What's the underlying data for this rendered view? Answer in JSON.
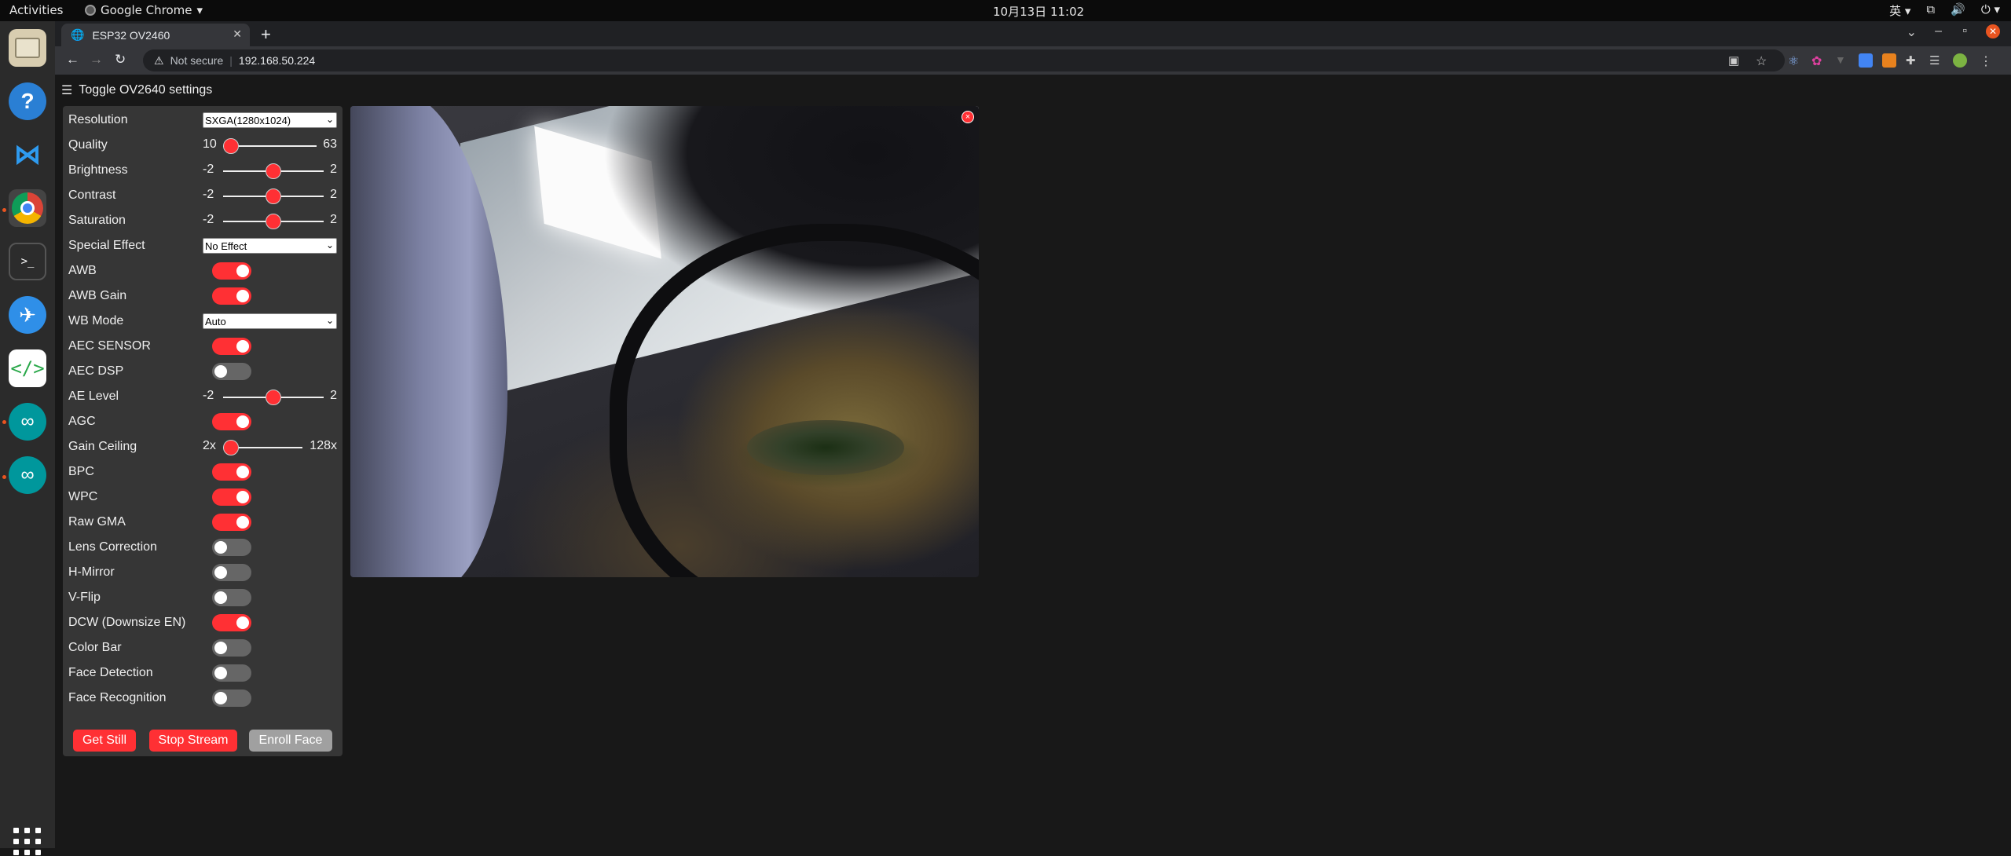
{
  "topbar": {
    "activities": "Activities",
    "app_name": "Google Chrome",
    "clock": "10月13日 11:02",
    "input_method": "英"
  },
  "dock": {
    "items": [
      "files-icon",
      "help-icon",
      "vscode-icon",
      "chrome-icon",
      "terminal-icon",
      "feishu-icon",
      "code-editor-icon",
      "arduino-icon",
      "arduino-icon-2"
    ],
    "apps_grid": "show-applications-icon"
  },
  "browser": {
    "tab_title": "ESP32 OV2460",
    "new_tab": "+",
    "not_secure": "Not secure",
    "url": "192.168.50.224",
    "window_controls": [
      "–",
      "▫",
      "✕"
    ]
  },
  "page": {
    "toggle_icon": "☰",
    "toggle_label": "Toggle OV2640 settings",
    "settings": [
      {
        "label": "Resolution",
        "type": "select",
        "value": "SXGA(1280x1024)"
      },
      {
        "label": "Quality",
        "type": "range",
        "min": "10",
        "max": "63",
        "level": 0.0
      },
      {
        "label": "Brightness",
        "type": "range",
        "min": "-2",
        "max": "2",
        "level": 0.5
      },
      {
        "label": "Contrast",
        "type": "range",
        "min": "-2",
        "max": "2",
        "level": 0.5
      },
      {
        "label": "Saturation",
        "type": "range",
        "min": "-2",
        "max": "2",
        "level": 0.5
      },
      {
        "label": "Special Effect",
        "type": "select",
        "value": "No Effect"
      },
      {
        "label": "AWB",
        "type": "switch",
        "on": true
      },
      {
        "label": "AWB Gain",
        "type": "switch",
        "on": true
      },
      {
        "label": "WB Mode",
        "type": "select",
        "value": "Auto"
      },
      {
        "label": "AEC SENSOR",
        "type": "switch",
        "on": true
      },
      {
        "label": "AEC DSP",
        "type": "switch",
        "on": false
      },
      {
        "label": "AE Level",
        "type": "range",
        "min": "-2",
        "max": "2",
        "level": 0.5
      },
      {
        "label": "AGC",
        "type": "switch",
        "on": true
      },
      {
        "label": "Gain Ceiling",
        "type": "range",
        "min": "2x",
        "max": "128x",
        "level": 0.0
      },
      {
        "label": "BPC",
        "type": "switch",
        "on": true
      },
      {
        "label": "WPC",
        "type": "switch",
        "on": true
      },
      {
        "label": "Raw GMA",
        "type": "switch",
        "on": true
      },
      {
        "label": "Lens Correction",
        "type": "switch",
        "on": false
      },
      {
        "label": "H-Mirror",
        "type": "switch",
        "on": false
      },
      {
        "label": "V-Flip",
        "type": "switch",
        "on": false
      },
      {
        "label": "DCW (Downsize EN)",
        "type": "switch",
        "on": true
      },
      {
        "label": "Color Bar",
        "type": "switch",
        "on": false
      },
      {
        "label": "Face Detection",
        "type": "switch",
        "on": false
      },
      {
        "label": "Face Recognition",
        "type": "switch",
        "on": false
      }
    ],
    "buttons": {
      "get_still": "Get Still",
      "stop_stream": "Stop Stream",
      "enroll_face": "Enroll Face"
    },
    "stream_close": "×"
  },
  "colors": {
    "accent": "#ff3034",
    "panel": "#363636",
    "background": "#181818",
    "switch_off": "#666666",
    "disabled_button": "#a0a0a0"
  }
}
